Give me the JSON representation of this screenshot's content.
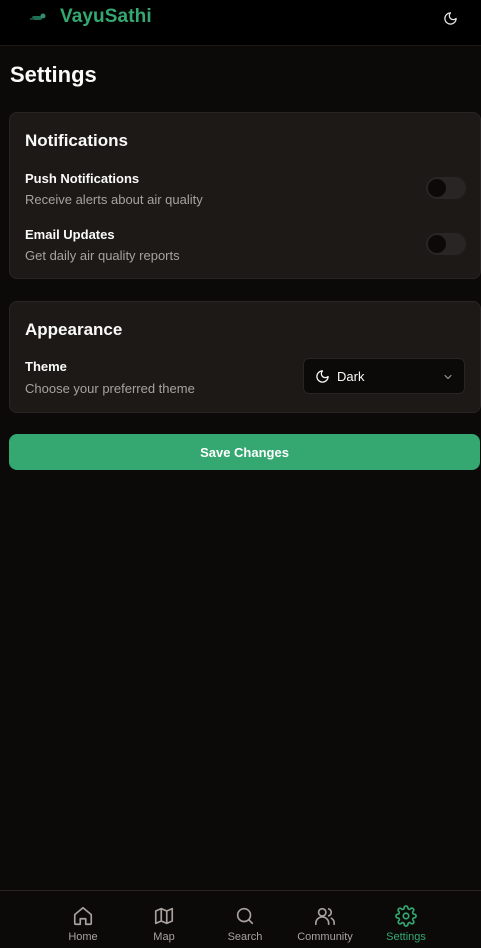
{
  "header": {
    "app_name": "VayuSathi",
    "logo_icon": "logo-icon",
    "theme_toggle_icon": "moon-icon"
  },
  "page": {
    "title": "Settings"
  },
  "notifications": {
    "title": "Notifications",
    "push": {
      "title": "Push Notifications",
      "description": "Receive alerts about air quality",
      "enabled": false
    },
    "email": {
      "title": "Email Updates",
      "description": "Get daily air quality reports",
      "enabled": false
    }
  },
  "appearance": {
    "title": "Appearance",
    "theme": {
      "title": "Theme",
      "description": "Choose your preferred theme",
      "selected": "Dark",
      "selected_icon": "moon-icon"
    }
  },
  "actions": {
    "save_label": "Save Changes"
  },
  "nav": {
    "items": [
      {
        "label": "Home",
        "icon": "home-icon",
        "active": false
      },
      {
        "label": "Map",
        "icon": "map-icon",
        "active": false
      },
      {
        "label": "Search",
        "icon": "search-icon",
        "active": false
      },
      {
        "label": "Community",
        "icon": "users-icon",
        "active": false
      },
      {
        "label": "Settings",
        "icon": "gear-icon",
        "active": true
      }
    ]
  },
  "colors": {
    "accent": "#34a870",
    "background": "#0c0a09",
    "card": "#1c1917",
    "muted_text": "#a8a29e"
  }
}
